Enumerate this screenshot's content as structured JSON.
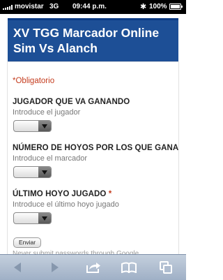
{
  "status_bar": {
    "carrier": "movistar",
    "network": "3G",
    "time": "09:44 p.m.",
    "bluetooth_icon": "bluetooth-icon",
    "battery_percent": "100%"
  },
  "form": {
    "title": "XV TGG Marcador Online Sim Vs Alanch",
    "required_note": "*Obligatorio",
    "questions": [
      {
        "title": "JUGADOR QUE VA GANANDO",
        "required": false,
        "help": "Introduce el jugador",
        "selected_value": ""
      },
      {
        "title": "NÚMERO DE HOYOS POR LOS QUE GANA",
        "required": false,
        "help": "Introduce el marcador",
        "selected_value": ""
      },
      {
        "title": "ÚLTIMO HOYO JUGADO",
        "required": true,
        "required_marker": "*",
        "help": "Introduce el último hoyo jugado",
        "selected_value": ""
      }
    ],
    "submit_label": "Enviar",
    "password_warning": "Never submit passwords through Google"
  },
  "toolbar": {
    "icons": [
      "back-arrow-icon",
      "forward-arrow-icon",
      "share-icon",
      "bookmarks-icon",
      "tabs-icon"
    ]
  },
  "colors": {
    "header_bg": "#1d4f96",
    "required_red": "#c43b1d",
    "toolbar_bg": "#afbdd0"
  }
}
